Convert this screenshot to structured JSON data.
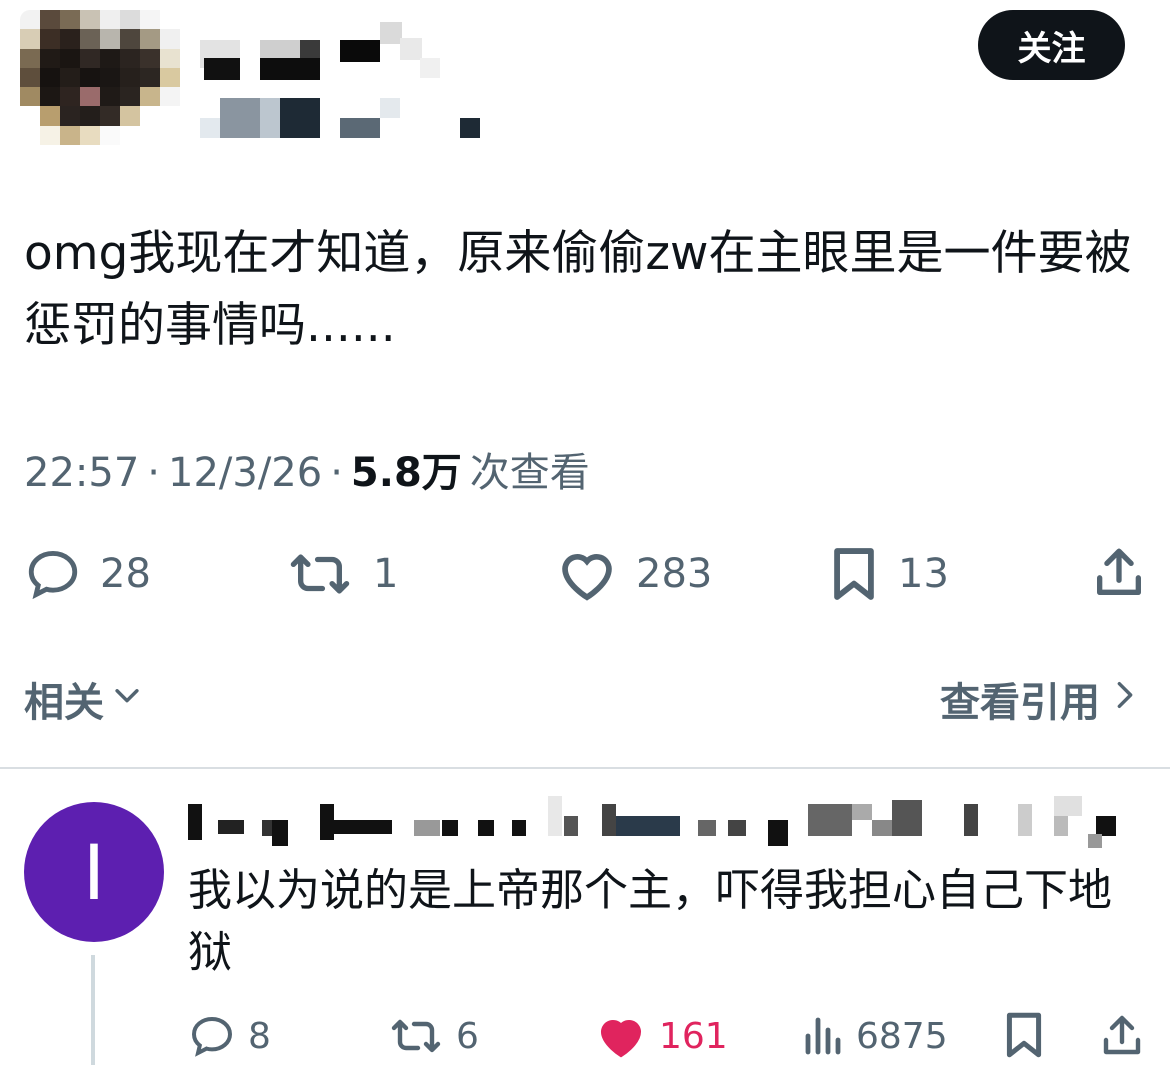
{
  "tweet": {
    "follow_label": "关注",
    "text": "omg我现在才知道，原来偷偷zw在主眼里是一件要被惩罚的事情吗......",
    "time": "22:57",
    "sep1": "·",
    "date": "12/3/26",
    "sep2": "·",
    "views": "5.8万",
    "views_label": "次查看",
    "actions": {
      "replies": "28",
      "retweets": "1",
      "likes": "283",
      "bookmarks": "13"
    },
    "related_label": "相关",
    "quotes_label": "查看引用"
  },
  "reply": {
    "avatar_letter": "I",
    "text": "我以为说的是上帝那个主，吓得我担心自己下地狱",
    "actions": {
      "replies": "8",
      "retweets": "6",
      "likes": "161",
      "views": "6875"
    }
  },
  "colors": {
    "text": "#0f1419",
    "muted": "#536471",
    "like_active": "#e0245e",
    "reply_avatar_bg": "#5d1fb0",
    "follow_bg": "#0f1419"
  },
  "icons": [
    "comment-icon",
    "retweet-icon",
    "heart-icon",
    "bookmark-icon",
    "share-icon",
    "chevron-down-icon",
    "chevron-right-icon",
    "views-icon"
  ]
}
